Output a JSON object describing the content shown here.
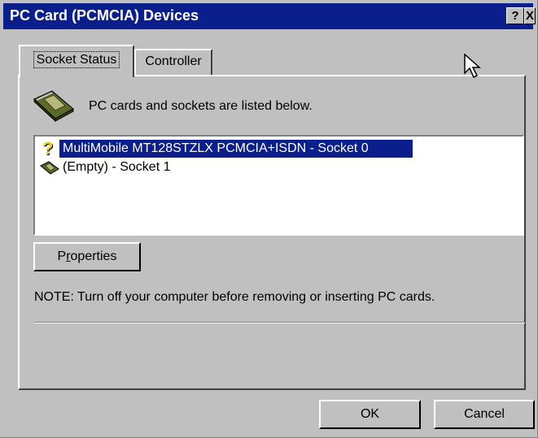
{
  "window": {
    "title": "PC Card (PCMCIA) Devices",
    "help_button": "?",
    "close_button": "X",
    "titlebar_color": "#0a1e8c"
  },
  "tabs": [
    {
      "label": "Socket Status",
      "selected": true
    },
    {
      "label": "Controller",
      "selected": false
    }
  ],
  "panel": {
    "intro_icon": "pc-card-icon",
    "intro_text": "PC cards and sockets are listed below.",
    "devices": [
      {
        "icon": "question-mark-icon",
        "label": "MultiMobile MT128STZLX PCMCIA+ISDN - Socket 0",
        "selected": true
      },
      {
        "icon": "pc-card-icon",
        "label": "(Empty) - Socket 1",
        "selected": false
      }
    ],
    "properties_button": {
      "accel": "r",
      "pre": "P",
      "post": "operties"
    },
    "note": "NOTE: Turn off your computer before removing or inserting  PC cards."
  },
  "buttons": {
    "ok": "OK",
    "cancel": "Cancel"
  },
  "selection_color": "#0a1e8c"
}
